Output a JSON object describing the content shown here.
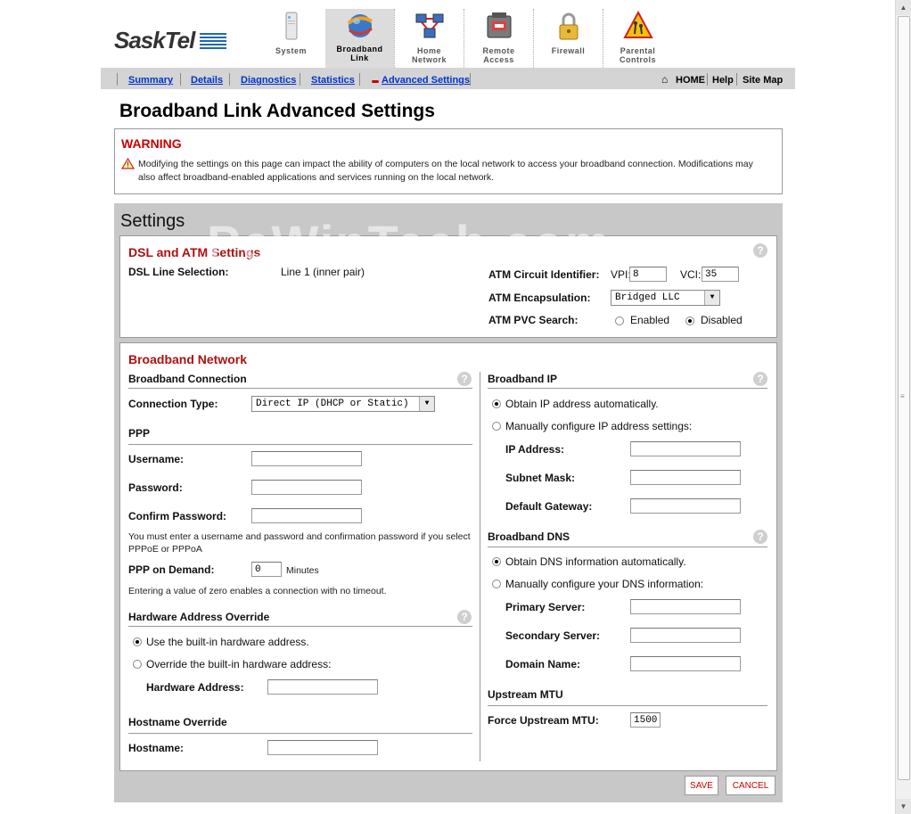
{
  "brand": "SaskTel",
  "nav": [
    {
      "label": "System",
      "icon": "system-icon"
    },
    {
      "label": "Broadband Link",
      "icon": "broadband-link-icon"
    },
    {
      "label": "Home Network",
      "icon": "home-network-icon"
    },
    {
      "label": "Remote Access",
      "icon": "remote-access-icon"
    },
    {
      "label": "Firewall",
      "icon": "firewall-lock-icon"
    },
    {
      "label": "Parental Controls",
      "icon": "parental-controls-icon"
    }
  ],
  "subnav": {
    "summary": "Summary",
    "details": "Details",
    "diagnostics": "Diagnostics",
    "statistics": "Statistics",
    "advanced": "Advanced Settings",
    "home": "HOME",
    "help": "Help",
    "sitemap": "Site Map"
  },
  "page_title": "Broadband Link Advanced Settings",
  "warning": {
    "title": "WARNING",
    "text": "Modifying the settings on this page can impact the ability of computers on the local network to access your broadband connection. Modifications may also affect broadband-enabled applications and services running on the local network."
  },
  "settings": {
    "title": "Settings",
    "watermark": "PcWinTech.com",
    "dsl": {
      "heading": "DSL and ATM Settings",
      "line_label": "DSL Line Selection:",
      "line_value": "Line 1 (inner pair)",
      "circuit_label": "ATM Circuit Identifier:",
      "vpi_label": "VPI:",
      "vpi_value": "8",
      "vci_label": "VCI:",
      "vci_value": "35",
      "encap_label": "ATM Encapsulation:",
      "encap_value": "Bridged LLC",
      "pvc_label": "ATM PVC Search:",
      "pvc_enabled": "Enabled",
      "pvc_disabled": "Disabled"
    },
    "network": {
      "heading": "Broadband Network",
      "conn_heading": "Broadband Connection",
      "conn_type_label": "Connection Type:",
      "conn_type_value": "Direct IP (DHCP or Static)",
      "ppp_heading": "PPP",
      "username_label": "Username:",
      "password_label": "Password:",
      "confirm_label": "Confirm Password:",
      "ppp_note": "You must enter a username and password and confirmation password if you select PPPoE or PPPoA",
      "demand_label": "PPP on Demand:",
      "demand_value": "0",
      "demand_unit": "Minutes",
      "demand_note": "Entering a value of zero enables a connection with no timeout.",
      "hw_heading": "Hardware Address Override",
      "hw_builtin": "Use the built-in hardware address.",
      "hw_override": "Override the built-in hardware address:",
      "hw_addr_label": "Hardware Address:",
      "host_heading": "Hostname Override",
      "host_label": "Hostname:",
      "ip_heading": "Broadband IP",
      "ip_auto": "Obtain IP address automatically.",
      "ip_manual": "Manually configure IP address settings:",
      "ip_addr_label": "IP Address:",
      "subnet_label": "Subnet Mask:",
      "gateway_label": "Default Gateway:",
      "dns_heading": "Broadband DNS",
      "dns_auto": "Obtain DNS information automatically.",
      "dns_manual": "Manually configure your DNS information:",
      "primary_label": "Primary Server:",
      "secondary_label": "Secondary Server:",
      "domain_label": "Domain Name:",
      "mtu_heading": "Upstream MTU",
      "mtu_label": "Force Upstream MTU:",
      "mtu_value": "1500"
    },
    "save": "SAVE",
    "cancel": "CANCEL"
  },
  "colors": {
    "accent_red": "#b01010",
    "link_blue": "#0033cc",
    "brand_blue": "#1f67b5"
  }
}
